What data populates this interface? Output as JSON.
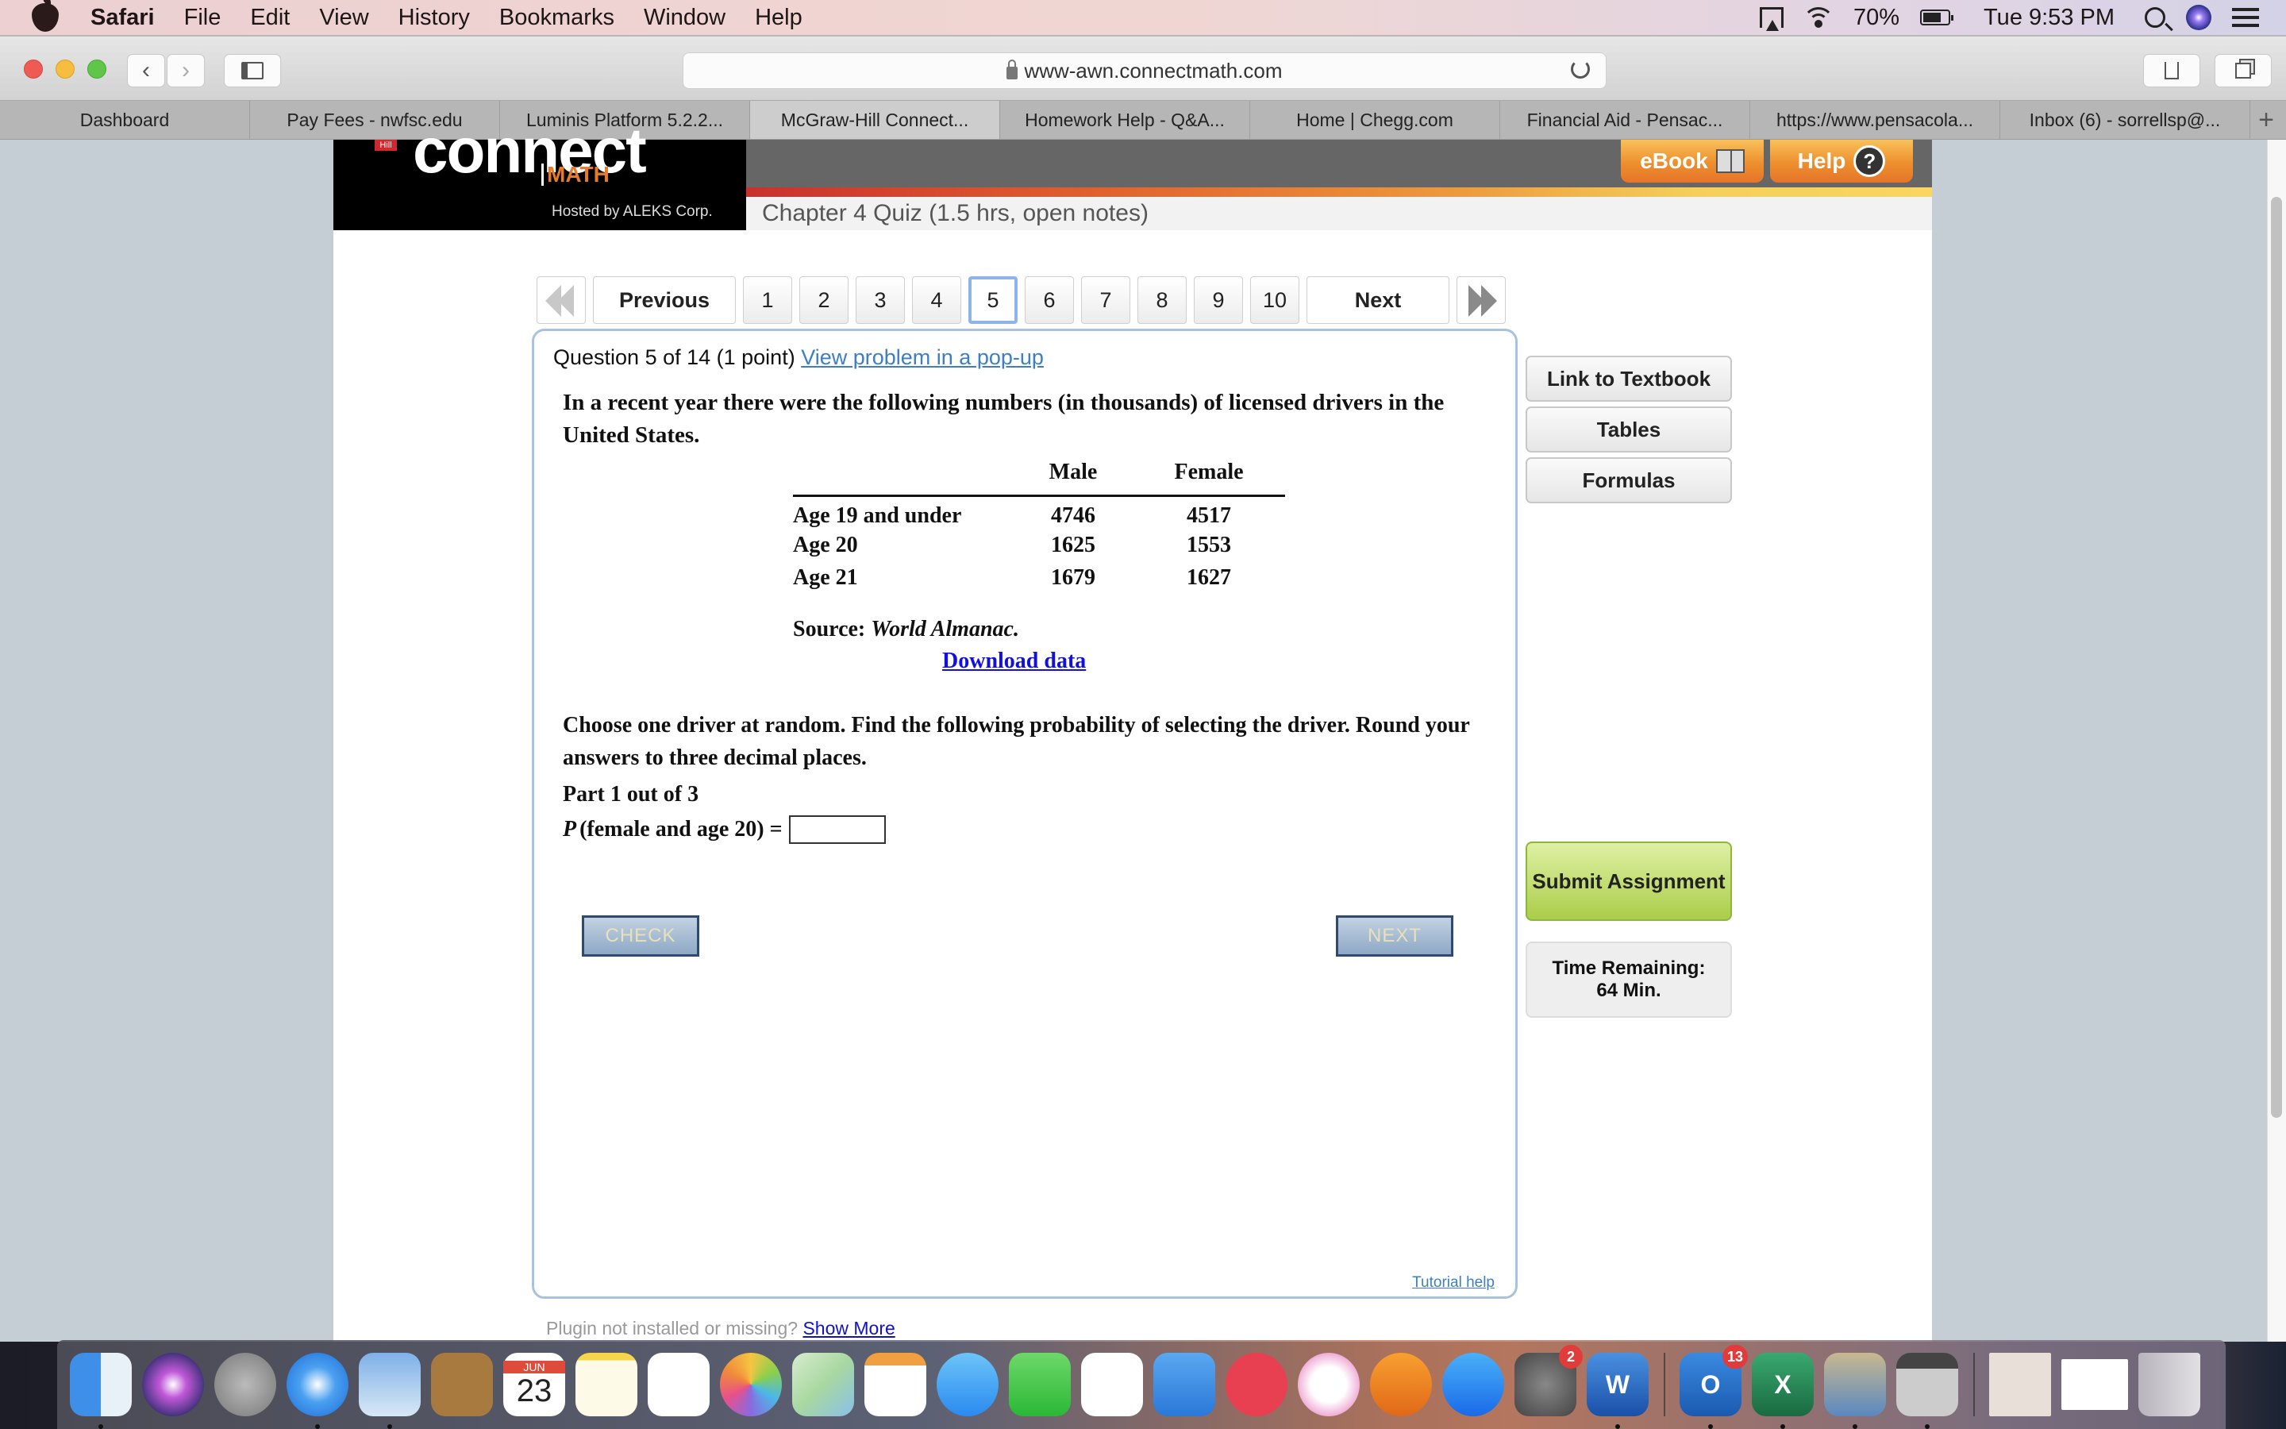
{
  "menubar": {
    "app_name": "Safari",
    "items": [
      "File",
      "Edit",
      "View",
      "History",
      "Bookmarks",
      "Window",
      "Help"
    ],
    "battery": "70%",
    "clock": "Tue 9:53 PM"
  },
  "browser": {
    "url": "www-awn.connectmath.com",
    "tabs": [
      {
        "label": "Dashboard",
        "active": false
      },
      {
        "label": "Pay Fees - nwfsc.edu",
        "active": false
      },
      {
        "label": "Luminis Platform 5.2.2...",
        "active": false
      },
      {
        "label": "McGraw-Hill Connect...",
        "active": true
      },
      {
        "label": "Homework Help - Q&A...",
        "active": false
      },
      {
        "label": "Home | Chegg.com",
        "active": false
      },
      {
        "label": "Financial Aid - Pensac...",
        "active": false
      },
      {
        "label": "https://www.pensacola...",
        "active": false
      },
      {
        "label": "Inbox (6) - sorrellsp@...",
        "active": false
      }
    ],
    "new_tab": "+"
  },
  "header": {
    "brand_connect": "connect",
    "brand_hill": "Hill",
    "brand_math": "MATH",
    "hosted_by": "Hosted by ALEKS Corp.",
    "ebook_label": "eBook",
    "help_label": "Help",
    "help_glyph": "?",
    "assignment_title": "Chapter 4 Quiz (1.5 hrs, open notes)"
  },
  "pager": {
    "previous": "Previous",
    "next": "Next",
    "pages": [
      "1",
      "2",
      "3",
      "4",
      "5",
      "6",
      "7",
      "8",
      "9",
      "10"
    ],
    "current": "5"
  },
  "question": {
    "header": "Question 5 of 14 (1 point)",
    "popup_link": "View problem in a pop-up",
    "intro": "In a recent year there were the following numbers (in thousands) of licensed drivers in the United States.",
    "table": {
      "columns": [
        "",
        "Male",
        "Female"
      ],
      "rows": [
        {
          "label": "Age 19 and under",
          "male": "4746",
          "female": "4517"
        },
        {
          "label": "Age 20",
          "male": "1625",
          "female": "1553"
        },
        {
          "label": "Age 21",
          "male": "1679",
          "female": "1627"
        }
      ]
    },
    "source_prefix": "Source:",
    "source_title": "World Almanac.",
    "download_link": "Download data",
    "instruction": "Choose one driver at random. Find the following probability of selecting the driver. Round your answers to three decimal places.",
    "part": "Part 1 out of 3",
    "prob_p": "P",
    "prob_expr": "(female and age 20) =",
    "answer_value": "",
    "check_label": "CHECK",
    "next_label": "NEXT",
    "tutorial_link": "Tutorial help"
  },
  "sidebar": {
    "link_textbook": "Link to Textbook",
    "tables": "Tables",
    "formulas": "Formulas",
    "submit": "Submit Assignment",
    "time_label": "Time Remaining:",
    "time_value": "64 Min."
  },
  "footer": {
    "plugin_text": "Plugin not installed or missing?",
    "show_more": "Show More"
  },
  "dock": {
    "calendar_month": "JUN",
    "calendar_day": "23",
    "apps": [
      "Finder",
      "Siri",
      "Launchpad",
      "Safari",
      "Mail",
      "Contacts",
      "Calendar",
      "Notes",
      "Reminders",
      "Photos",
      "Maps",
      "Pages",
      "Messages",
      "FaceTime",
      "Numbers",
      "Keynote",
      "News",
      "iTunes",
      "Books",
      "App Store",
      "System Preferences",
      "Word",
      "Outlook",
      "Excel",
      "Preview",
      "Calculator",
      "Downloads",
      "Document",
      "Trash"
    ],
    "badges": {
      "system_preferences": "2",
      "outlook": "13"
    }
  }
}
